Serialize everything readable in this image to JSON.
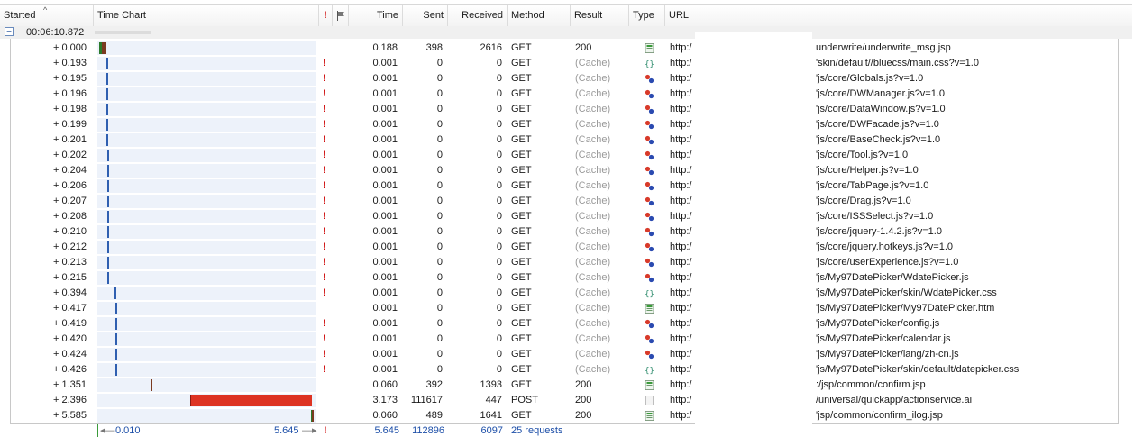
{
  "header": {
    "started": "Started",
    "time_chart": "Time Chart",
    "warn": "!",
    "time": "Time",
    "sent": "Sent",
    "received": "Received",
    "method": "Method",
    "result": "Result",
    "type": "Type",
    "url": "URL"
  },
  "group": {
    "time": "00:06:10.872"
  },
  "rows": [
    {
      "started": "+ 0.000",
      "warn": "",
      "time": "0.188",
      "sent": "398",
      "received": "2616",
      "method": "GET",
      "result": "200",
      "icon": "html-page-icon",
      "url_prefix": "http:/",
      "url_tail": "underwrite/underwrite_msg.jsp"
    },
    {
      "started": "+ 0.193",
      "warn": "!",
      "time": "0.001",
      "sent": "0",
      "received": "0",
      "method": "GET",
      "result": "(Cache)",
      "icon": "css-icon",
      "url_prefix": "http:/",
      "url_tail": "'skin/default//bluecss/main.css?v=1.0"
    },
    {
      "started": "+ 0.195",
      "warn": "!",
      "time": "0.001",
      "sent": "0",
      "received": "0",
      "method": "GET",
      "result": "(Cache)",
      "icon": "script-icon",
      "url_prefix": "http:/",
      "url_tail": "'js/core/Globals.js?v=1.0"
    },
    {
      "started": "+ 0.196",
      "warn": "!",
      "time": "0.001",
      "sent": "0",
      "received": "0",
      "method": "GET",
      "result": "(Cache)",
      "icon": "script-icon",
      "url_prefix": "http:/",
      "url_tail": "'js/core/DWManager.js?v=1.0"
    },
    {
      "started": "+ 0.198",
      "warn": "!",
      "time": "0.001",
      "sent": "0",
      "received": "0",
      "method": "GET",
      "result": "(Cache)",
      "icon": "script-icon",
      "url_prefix": "http:/",
      "url_tail": "'js/core/DataWindow.js?v=1.0"
    },
    {
      "started": "+ 0.199",
      "warn": "!",
      "time": "0.001",
      "sent": "0",
      "received": "0",
      "method": "GET",
      "result": "(Cache)",
      "icon": "script-icon",
      "url_prefix": "http:/",
      "url_tail": "'js/core/DWFacade.js?v=1.0"
    },
    {
      "started": "+ 0.201",
      "warn": "!",
      "time": "0.001",
      "sent": "0",
      "received": "0",
      "method": "GET",
      "result": "(Cache)",
      "icon": "script-icon",
      "url_prefix": "http:/",
      "url_tail": "'js/core/BaseCheck.js?v=1.0"
    },
    {
      "started": "+ 0.202",
      "warn": "!",
      "time": "0.001",
      "sent": "0",
      "received": "0",
      "method": "GET",
      "result": "(Cache)",
      "icon": "script-icon",
      "url_prefix": "http:/",
      "url_tail": "'js/core/Tool.js?v=1.0"
    },
    {
      "started": "+ 0.204",
      "warn": "!",
      "time": "0.001",
      "sent": "0",
      "received": "0",
      "method": "GET",
      "result": "(Cache)",
      "icon": "script-icon",
      "url_prefix": "http:/",
      "url_tail": "'js/core/Helper.js?v=1.0"
    },
    {
      "started": "+ 0.206",
      "warn": "!",
      "time": "0.001",
      "sent": "0",
      "received": "0",
      "method": "GET",
      "result": "(Cache)",
      "icon": "script-icon",
      "url_prefix": "http:/",
      "url_tail": "'js/core/TabPage.js?v=1.0"
    },
    {
      "started": "+ 0.207",
      "warn": "!",
      "time": "0.001",
      "sent": "0",
      "received": "0",
      "method": "GET",
      "result": "(Cache)",
      "icon": "script-icon",
      "url_prefix": "http:/",
      "url_tail": "'js/core/Drag.js?v=1.0"
    },
    {
      "started": "+ 0.208",
      "warn": "!",
      "time": "0.001",
      "sent": "0",
      "received": "0",
      "method": "GET",
      "result": "(Cache)",
      "icon": "script-icon",
      "url_prefix": "http:/",
      "url_tail": "'js/core/ISSSelect.js?v=1.0"
    },
    {
      "started": "+ 0.210",
      "warn": "!",
      "time": "0.001",
      "sent": "0",
      "received": "0",
      "method": "GET",
      "result": "(Cache)",
      "icon": "script-icon",
      "url_prefix": "http:/",
      "url_tail": "'js/core/jquery-1.4.2.js?v=1.0"
    },
    {
      "started": "+ 0.212",
      "warn": "!",
      "time": "0.001",
      "sent": "0",
      "received": "0",
      "method": "GET",
      "result": "(Cache)",
      "icon": "script-icon",
      "url_prefix": "http:/",
      "url_tail": "'js/core/jquery.hotkeys.js?v=1.0"
    },
    {
      "started": "+ 0.213",
      "warn": "!",
      "time": "0.001",
      "sent": "0",
      "received": "0",
      "method": "GET",
      "result": "(Cache)",
      "icon": "script-icon",
      "url_prefix": "http:/",
      "url_tail": "'js/core/userExperience.js?v=1.0"
    },
    {
      "started": "+ 0.215",
      "warn": "!",
      "time": "0.001",
      "sent": "0",
      "received": "0",
      "method": "GET",
      "result": "(Cache)",
      "icon": "script-icon",
      "url_prefix": "http:/",
      "url_tail": "'js/My97DatePicker/WdatePicker.js"
    },
    {
      "started": "+ 0.394",
      "warn": "!",
      "time": "0.001",
      "sent": "0",
      "received": "0",
      "method": "GET",
      "result": "(Cache)",
      "icon": "css-icon",
      "url_prefix": "http:/",
      "url_tail": "'js/My97DatePicker/skin/WdatePicker.css"
    },
    {
      "started": "+ 0.417",
      "warn": "",
      "time": "0.001",
      "sent": "0",
      "received": "0",
      "method": "GET",
      "result": "(Cache)",
      "icon": "html-page-icon",
      "url_prefix": "http:/",
      "url_tail": "'js/My97DatePicker/My97DatePicker.htm"
    },
    {
      "started": "+ 0.419",
      "warn": "!",
      "time": "0.001",
      "sent": "0",
      "received": "0",
      "method": "GET",
      "result": "(Cache)",
      "icon": "script-icon",
      "url_prefix": "http:/",
      "url_tail": "'js/My97DatePicker/config.js"
    },
    {
      "started": "+ 0.420",
      "warn": "!",
      "time": "0.001",
      "sent": "0",
      "received": "0",
      "method": "GET",
      "result": "(Cache)",
      "icon": "script-icon",
      "url_prefix": "http:/",
      "url_tail": "'js/My97DatePicker/calendar.js"
    },
    {
      "started": "+ 0.424",
      "warn": "!",
      "time": "0.001",
      "sent": "0",
      "received": "0",
      "method": "GET",
      "result": "(Cache)",
      "icon": "script-icon",
      "url_prefix": "http:/",
      "url_tail": "'js/My97DatePicker/lang/zh-cn.js"
    },
    {
      "started": "+ 0.426",
      "warn": "!",
      "time": "0.001",
      "sent": "0",
      "received": "0",
      "method": "GET",
      "result": "(Cache)",
      "icon": "css-icon",
      "url_prefix": "http:/",
      "url_tail": "'js/My97DatePicker/skin/default/datepicker.css"
    },
    {
      "started": "+ 1.351",
      "warn": "",
      "time": "0.060",
      "sent": "392",
      "received": "1393",
      "method": "GET",
      "result": "200",
      "icon": "html-page-icon",
      "url_prefix": "http:/",
      "url_tail": ":/jsp/common/confirm.jsp"
    },
    {
      "started": "+ 2.396",
      "warn": "",
      "time": "3.173",
      "sent": "111617",
      "received": "447",
      "method": "POST",
      "result": "200",
      "icon": "blank-page-icon",
      "url_prefix": "http:/",
      "url_tail": "/universal/quickapp/actionservice.ai"
    },
    {
      "started": "+ 5.585",
      "warn": "",
      "time": "0.060",
      "sent": "489",
      "received": "1641",
      "method": "GET",
      "result": "200",
      "icon": "html-page-icon",
      "url_prefix": "http:/",
      "url_tail": "'jsp/common/confirm_ilog.jsp"
    }
  ],
  "footer": {
    "range_start": "0.010",
    "range_end": "5.645",
    "warn": "!",
    "total_time": "5.645",
    "total_sent": "112896",
    "total_received": "6097",
    "summary": "25 requests"
  },
  "colors": {
    "accent": "#1d4fa8",
    "warning": "#cc0000",
    "post_bar": "#dd3322",
    "timeline_bg": "#edf2fa"
  }
}
